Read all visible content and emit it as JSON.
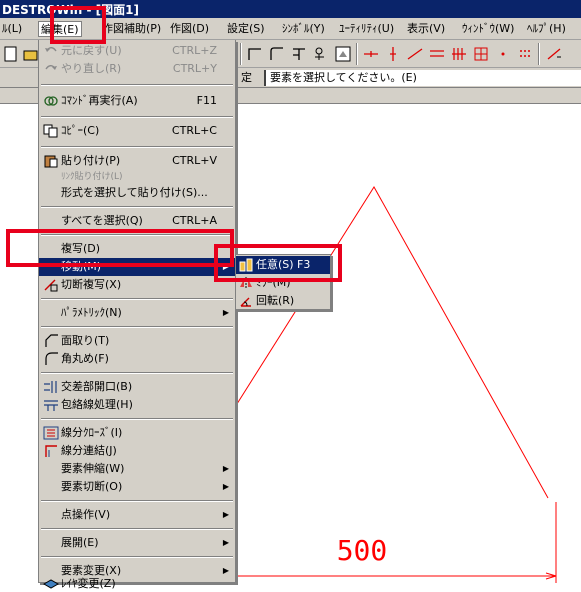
{
  "window": {
    "title": "DESTROWin - [図面1]"
  },
  "menubar": {
    "items": [
      {
        "label": "ﾙ(L)"
      },
      {
        "label": "編集(E)"
      },
      {
        "label": "作図補助(P)"
      },
      {
        "label": "作図(D)"
      },
      {
        "label": "設定(S)"
      },
      {
        "label": "ｼﾝﾎﾞﾙ(Y)"
      },
      {
        "label": "ﾕｰﾃｨﾘﾃｨ(U)"
      },
      {
        "label": "表示(V)"
      },
      {
        "label": "ｳｨﾝﾄﾞｳ(W)"
      },
      {
        "label": "ﾍﾙﾌﾟ(H)"
      }
    ]
  },
  "status": {
    "left_label": "定",
    "message": "要素を選択してください。(E)"
  },
  "edit_menu": {
    "items": [
      {
        "label": "元に戻す(U)",
        "shortcut": "CTRL+Z",
        "icon": "undo-icon"
      },
      {
        "label": "やり直し(R)",
        "shortcut": "CTRL+Y",
        "icon": "redo-icon"
      },
      {
        "label": "ｺﾏﾝﾄﾞ再実行(A)",
        "shortcut": "F11",
        "icon": "repeat-icon"
      },
      {
        "label": "ｺﾋﾟｰ(C)",
        "shortcut": "CTRL+C",
        "icon": "copy-icon"
      },
      {
        "label": "貼り付け(P)",
        "shortcut": "CTRL+V",
        "icon": "paste-icon"
      },
      {
        "label": "ﾘﾝｸ貼り付け(L)",
        "shortcut": ""
      },
      {
        "label": "形式を選択して貼り付け(S)...",
        "shortcut": ""
      },
      {
        "label": "すべてを選択(Q)",
        "shortcut": "CTRL+A"
      },
      {
        "label": "複写(D)",
        "shortcut": ""
      },
      {
        "label": "移動(M)",
        "shortcut": ""
      },
      {
        "label": "切断複写(X)",
        "shortcut": "",
        "icon": "cut-copy-icon"
      },
      {
        "label": "ﾊﾟﾗﾒﾄﾘｯｸ(N)",
        "shortcut": ""
      },
      {
        "label": "面取り(T)",
        "shortcut": "",
        "icon": "chamfer-icon"
      },
      {
        "label": "角丸め(F)",
        "shortcut": "",
        "icon": "fillet-icon"
      },
      {
        "label": "交差部開口(B)",
        "shortcut": "",
        "icon": "intersection-icon"
      },
      {
        "label": "包絡線処理(H)",
        "shortcut": "",
        "icon": "envelope-icon"
      },
      {
        "label": "線分ｸﾛｰｽﾞ(I)",
        "shortcut": "",
        "icon": "segment-close-icon"
      },
      {
        "label": "線分連結(J)",
        "shortcut": "",
        "icon": "segment-join-icon"
      },
      {
        "label": "要素伸縮(W)",
        "shortcut": ""
      },
      {
        "label": "要素切断(O)",
        "shortcut": ""
      },
      {
        "label": "点操作(V)",
        "shortcut": ""
      },
      {
        "label": "展開(E)",
        "shortcut": ""
      },
      {
        "label": "要素変更(X)",
        "shortcut": ""
      },
      {
        "label": "ﾚｲﾔ変更(Z)",
        "shortcut": "",
        "icon": "layer-icon"
      }
    ]
  },
  "move_submenu": {
    "items": [
      {
        "label": "任意(S)  F3",
        "icon": "move-arbitrary-icon"
      },
      {
        "label": "ﾐﾗｰ(M)",
        "icon": "mirror-icon"
      },
      {
        "label": "回転(R)",
        "icon": "rotate-icon"
      }
    ]
  },
  "drawing": {
    "dimension_text": "500",
    "line_color": "#ff0000"
  },
  "colors": {
    "highlight": "#e8001c",
    "menu_bg": "#d4d0c8",
    "selection": "#0a246a"
  }
}
